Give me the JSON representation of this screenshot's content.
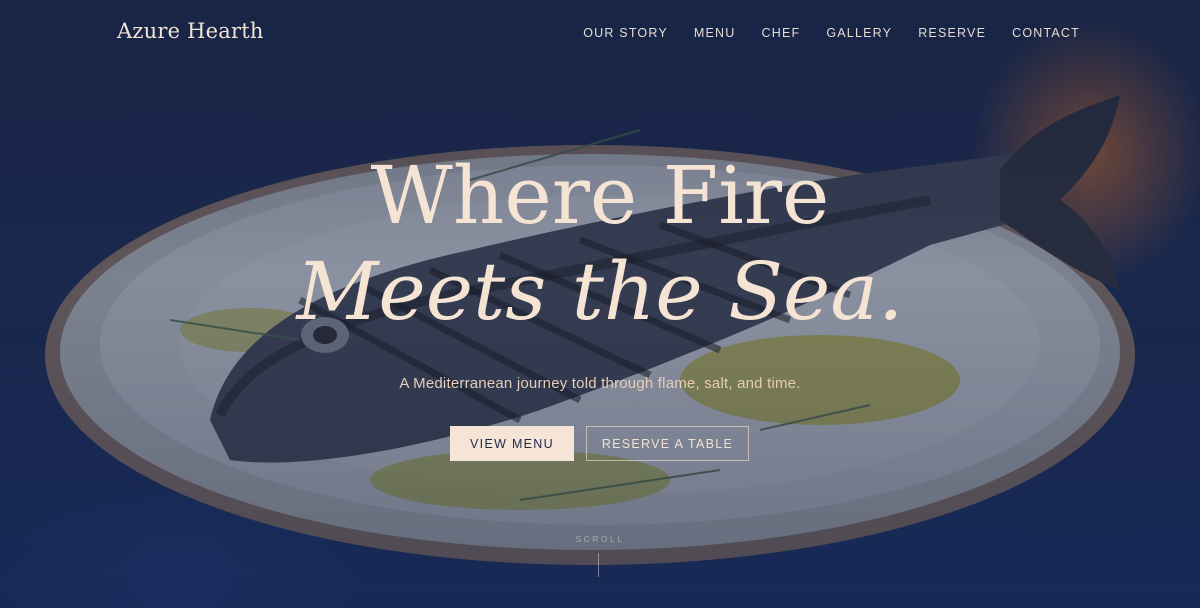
{
  "brand": {
    "name": "Azure Hearth"
  },
  "nav": {
    "items": [
      {
        "label": "OUR STORY"
      },
      {
        "label": "MENU"
      },
      {
        "label": "CHEF"
      },
      {
        "label": "GALLERY"
      },
      {
        "label": "RESERVE"
      },
      {
        "label": "CONTACT"
      }
    ]
  },
  "hero": {
    "headline_line1": "Where Fire",
    "headline_line2": "Meets the Sea.",
    "subtitle": "A Mediterranean journey told through flame, salt, and time.",
    "primary_button": "VIEW MENU",
    "secondary_button": "RESERVE A TABLE",
    "scroll_label": "SCROLL"
  },
  "colors": {
    "background": "#1a2748",
    "accent": "#f6e4d6",
    "text_light": "#f5e3d3"
  }
}
